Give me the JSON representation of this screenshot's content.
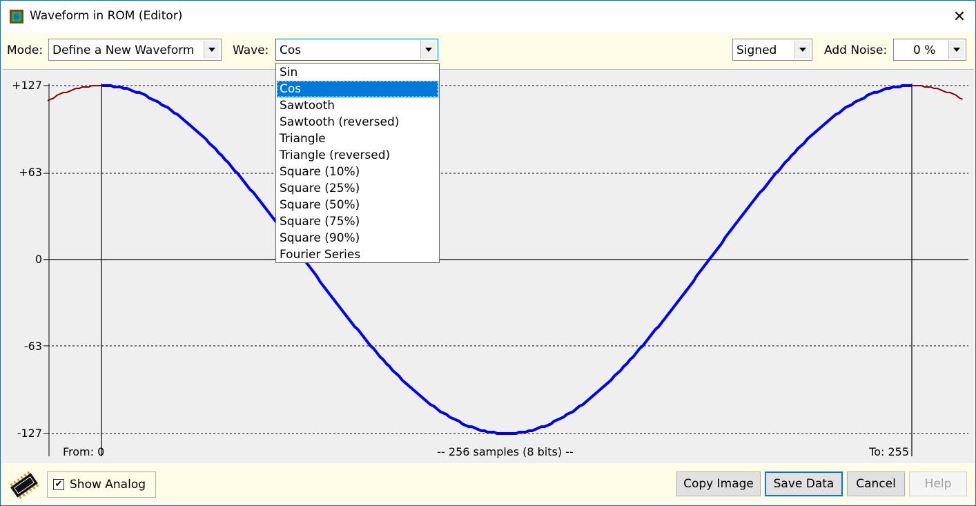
{
  "window": {
    "title": "Waveform in ROM (Editor)",
    "close_glyph": "✕"
  },
  "toolbar": {
    "mode_label": "Mode:",
    "mode_value": "Define a New Waveform",
    "wave_label": "Wave:",
    "wave_value": "Cos",
    "sign_value": "Signed",
    "noise_label": "Add Noise:",
    "noise_value": "0 %"
  },
  "wave_options": [
    "Sin",
    "Cos",
    "Sawtooth",
    "Sawtooth (reversed)",
    "Triangle",
    "Triangle (reversed)",
    "Square (10%)",
    "Square (25%)",
    "Square (50%)",
    "Square (75%)",
    "Square (90%)",
    "Fourier Series"
  ],
  "wave_selected_index": 1,
  "plot": {
    "y_ticks": [
      "+127",
      "+63",
      "0",
      "-63",
      "-127"
    ],
    "from_label": "From: 0",
    "to_label": "To: 255",
    "samples_label": "-- 256 samples (8 bits) --",
    "wave_color": "#0000ee",
    "outside_color": "#8b0000",
    "num_samples": 256,
    "amplitude": 127
  },
  "bottom": {
    "show_analog_label": "Show Analog",
    "show_analog_checked": true,
    "check_glyph": "✔",
    "copy_label": "Copy Image",
    "save_label": "Save Data",
    "cancel_label": "Cancel",
    "help_label": "Help"
  }
}
